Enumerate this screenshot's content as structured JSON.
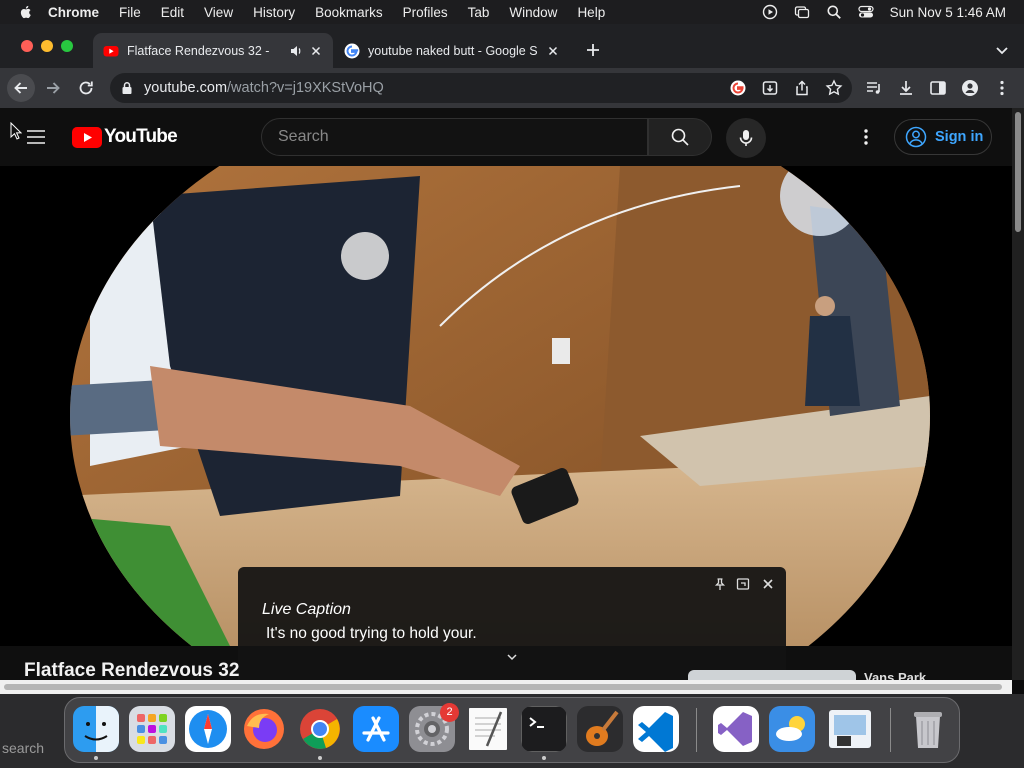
{
  "menubar": {
    "items": [
      "Chrome",
      "File",
      "Edit",
      "View",
      "History",
      "Bookmarks",
      "Profiles",
      "Tab",
      "Window",
      "Help"
    ],
    "datetime": "Sun Nov 5  1:46 AM"
  },
  "tabs": [
    {
      "title": "Flatface Rendezvous 32 -",
      "active": true
    },
    {
      "title": "youtube naked butt - Google S",
      "active": false
    }
  ],
  "address": {
    "domain": "youtube.com",
    "path": "/watch?v=j19XKStVoHQ"
  },
  "youtube": {
    "logo_text": "YouTube",
    "search_placeholder": "Search",
    "signin_label": "Sign in",
    "video_title": "Flatface Rendezvous 32",
    "side_label": "Vans Park"
  },
  "caption": {
    "title": "Live Caption",
    "text": "It's no good trying to hold your."
  },
  "dock": {
    "notification_count": "2"
  },
  "desktop": {
    "search_text": "search"
  },
  "colors": {
    "youtube_red": "#ff0000",
    "signin_blue": "#3ea6ff",
    "tab_active": "#35363a"
  }
}
